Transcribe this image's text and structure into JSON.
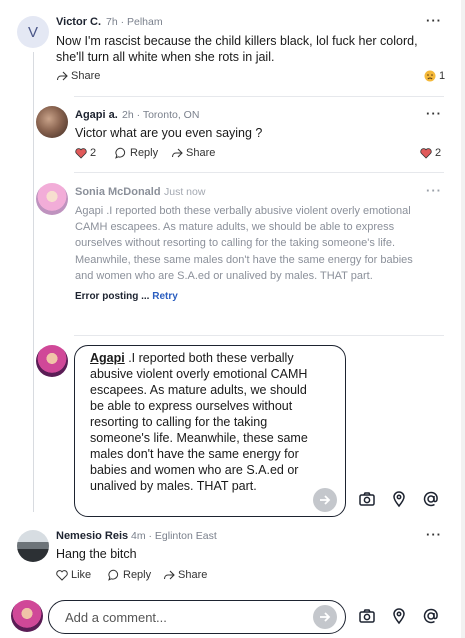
{
  "comments": [
    {
      "author": "Victor C.",
      "meta": "7h · Pelham",
      "avatar_letter": "V",
      "text": "Now I'm rascist because the child killers black, lol fuck her colord, she'll turn all white when she rots in jail.",
      "share_label": "Share",
      "reaction_icon": "sad-emoji",
      "reaction_count": "1"
    },
    {
      "author": "Agapi a.",
      "meta": "2h · Toronto, ON",
      "text": "Victor what are you even saying ?",
      "like_count": "2",
      "reply_label": "Reply",
      "share_label": "Share",
      "reaction_icon": "heart",
      "reaction_count": "2"
    },
    {
      "author": "Sonia McDonald",
      "meta": "Just now",
      "text": "Agapi .I reported both these verbally abusive violent overly emotional CAMH escapees. As mature adults, we should be able to express ourselves without resorting to calling for the taking someone's life. Meanwhile, these same males don't have the same energy for babies and women who are S.A.ed or unalived by males. THAT part.",
      "error_label": "Error posting ... ",
      "retry_label": "Retry"
    },
    {
      "author": "Nemesio Reis",
      "meta": "4m · Eglinton East",
      "text": "Hang the bitch",
      "like_label": "Like",
      "reply_label": "Reply",
      "share_label": "Share"
    }
  ],
  "reply_composer": {
    "mention": "Agapi",
    "text": " .I reported both these verbally abusive violent overly emotional CAMH escapees. As mature adults, we should be able to express ourselves without resorting to calling for the taking someone's life. Meanwhile, these same males don't have the same energy for babies and women who are S.A.ed or unalived by males. THAT part."
  },
  "bottom_composer": {
    "placeholder": "Add a comment..."
  },
  "more_label": "···",
  "colors": {
    "text": "#1a1a1a",
    "muted": "#7a808c",
    "link": "#2a5dbf",
    "divider": "#e6e8ec",
    "send": "#c4c7cc",
    "heart": "#e05a5a"
  }
}
